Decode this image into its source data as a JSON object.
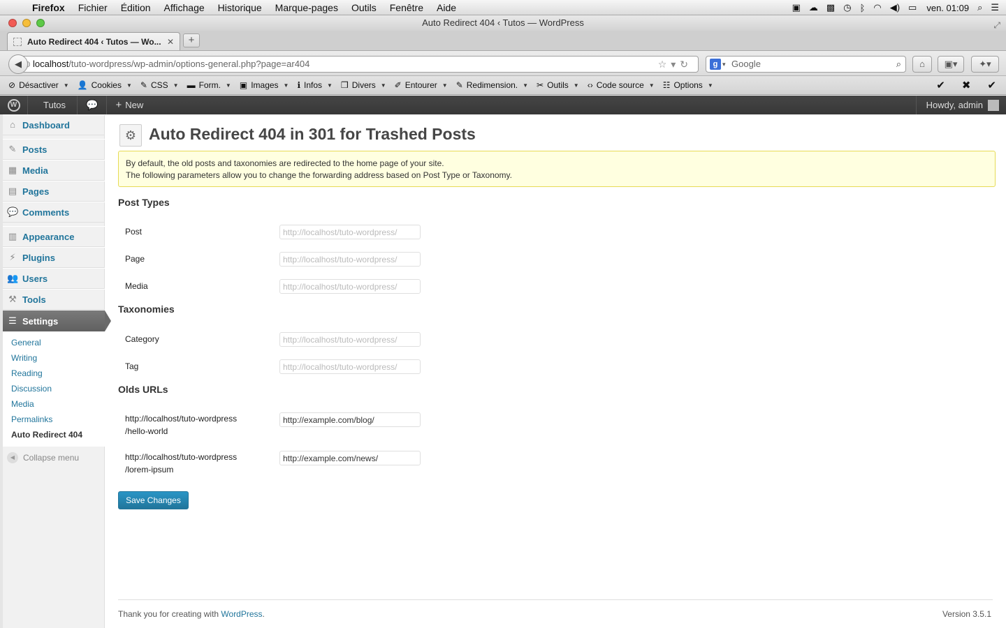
{
  "mac": {
    "app": "Firefox",
    "menus": [
      "Fichier",
      "Édition",
      "Affichage",
      "Historique",
      "Marque-pages",
      "Outils",
      "Fenêtre",
      "Aide"
    ],
    "clock": "ven. 01:09"
  },
  "window": {
    "title": "Auto Redirect 404 ‹ Tutos — WordPress"
  },
  "tab": {
    "label": "Auto Redirect 404 ‹ Tutos — Wo..."
  },
  "nav": {
    "url_host": "localhost",
    "url_path": "/tuto-wordpress/wp-admin/options-general.php?page=ar404",
    "search_placeholder": "Google"
  },
  "devbar": {
    "items": [
      {
        "icon": "⊘",
        "label": "Désactiver"
      },
      {
        "icon": "👤",
        "label": "Cookies"
      },
      {
        "icon": "✎",
        "label": "CSS"
      },
      {
        "icon": "▬",
        "label": "Form."
      },
      {
        "icon": "▣",
        "label": "Images"
      },
      {
        "icon": "ℹ",
        "label": "Infos"
      },
      {
        "icon": "❒",
        "label": "Divers"
      },
      {
        "icon": "✐",
        "label": "Entourer"
      },
      {
        "icon": "✎",
        "label": "Redimension."
      },
      {
        "icon": "✂",
        "label": "Outils"
      },
      {
        "icon": "‹›",
        "label": "Code source"
      },
      {
        "icon": "☷",
        "label": "Options"
      }
    ]
  },
  "adminbar": {
    "site": "Tutos",
    "new_label": "New",
    "howdy": "Howdy, admin"
  },
  "sidebar": {
    "items": [
      {
        "label": "Dashboard",
        "icon": "⌂"
      },
      {
        "label": "Posts",
        "icon": "✎"
      },
      {
        "label": "Media",
        "icon": "▦"
      },
      {
        "label": "Pages",
        "icon": "▤"
      },
      {
        "label": "Comments",
        "icon": "💬"
      },
      {
        "label": "Appearance",
        "icon": "▥"
      },
      {
        "label": "Plugins",
        "icon": "⚡"
      },
      {
        "label": "Users",
        "icon": "👥"
      },
      {
        "label": "Tools",
        "icon": "⚒"
      },
      {
        "label": "Settings",
        "icon": "☰"
      }
    ],
    "submenu": [
      "General",
      "Writing",
      "Reading",
      "Discussion",
      "Media",
      "Permalinks",
      "Auto Redirect 404"
    ],
    "collapse": "Collapse menu"
  },
  "page": {
    "title": "Auto Redirect 404 in 301 for Trashed Posts",
    "notice_line1": "By default, the old posts and taxonomies are redirected to the home page of your site.",
    "notice_line2": "The following parameters allow you to change the forwarding address based on Post Type or Taxonomy.",
    "sections": {
      "post_types": "Post Types",
      "taxonomies": "Taxonomies",
      "olds": "Olds URLs"
    },
    "placeholder": "http://localhost/tuto-wordpress/",
    "fields": {
      "post": "Post",
      "page": "Page",
      "media": "Media",
      "category": "Category",
      "tag": "Tag"
    },
    "olds": [
      {
        "line1": "http://localhost/tuto-wordpress",
        "line2": "/hello-world",
        "value": "http://example.com/blog/"
      },
      {
        "line1": "http://localhost/tuto-wordpress",
        "line2": "/lorem-ipsum",
        "value": "http://example.com/news/"
      }
    ],
    "save": "Save Changes"
  },
  "footer": {
    "thanks": "Thank you for creating with ",
    "wp": "WordPress",
    "dot": ".",
    "version": "Version 3.5.1"
  },
  "colors": {
    "link": "#21759b",
    "notice_bg": "#ffffe0",
    "adminbar": "#464646"
  }
}
